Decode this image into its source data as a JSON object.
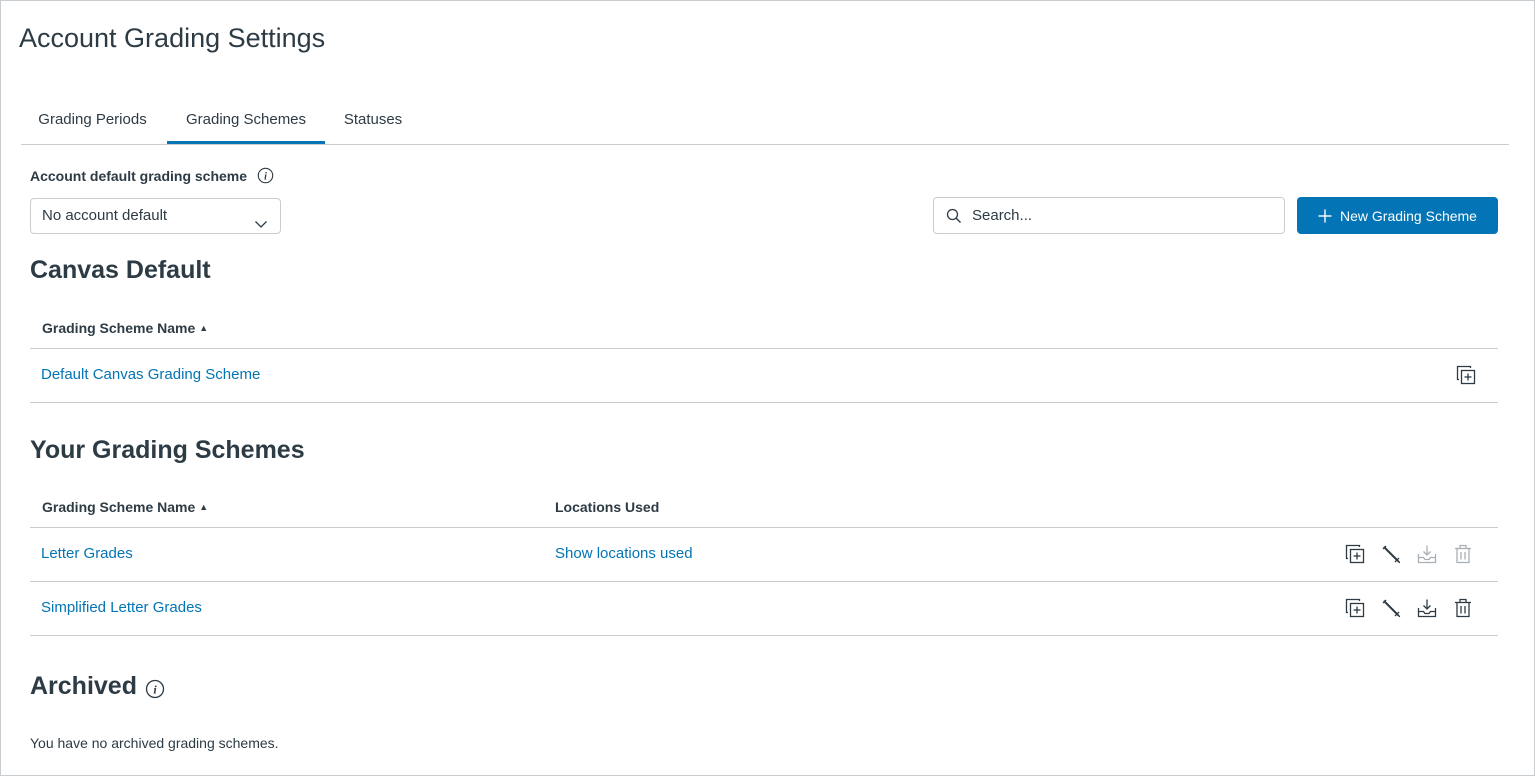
{
  "page": {
    "title": "Account Grading Settings"
  },
  "tabs": [
    {
      "label": "Grading Periods",
      "active": false
    },
    {
      "label": "Grading Schemes",
      "active": true
    },
    {
      "label": "Statuses",
      "active": false
    }
  ],
  "default_scheme": {
    "label": "Account default grading scheme",
    "selected": "No account default"
  },
  "search": {
    "placeholder": "Search..."
  },
  "new_button": {
    "label": "New Grading Scheme"
  },
  "canvas_default": {
    "title": "Canvas Default",
    "column_name": "Grading Scheme Name",
    "rows": [
      {
        "name": "Default Canvas Grading Scheme"
      }
    ]
  },
  "your_schemes": {
    "title": "Your Grading Schemes",
    "column_name": "Grading Scheme Name",
    "column_locations": "Locations Used",
    "rows": [
      {
        "name": "Letter Grades",
        "locations": "Show locations used",
        "archive_enabled": false,
        "delete_enabled": false
      },
      {
        "name": "Simplified Letter Grades",
        "locations": "",
        "archive_enabled": true,
        "delete_enabled": true
      }
    ]
  },
  "archived": {
    "title": "Archived",
    "empty_message": "You have no archived grading schemes."
  },
  "colors": {
    "accent": "#0374b5",
    "text": "#2d3b45",
    "border": "#c7cdd1",
    "disabled_icon": "#a8b0b5"
  },
  "icons": {
    "info": "info-icon",
    "chevron": "chevron-down-icon",
    "search": "search-icon",
    "plus": "plus-icon",
    "duplicate": "duplicate-icon",
    "edit": "pencil-icon",
    "archive": "archive-icon",
    "delete": "trash-icon"
  }
}
